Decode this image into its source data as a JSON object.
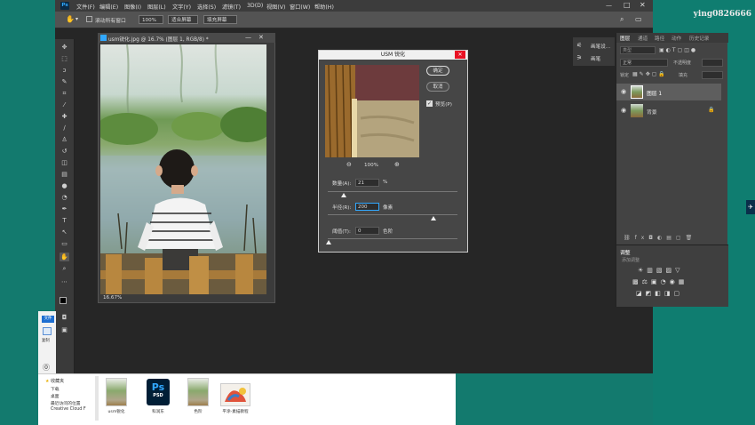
{
  "watermark": "ying0826666",
  "menu": [
    "文件(F)",
    "编辑(E)",
    "图像(I)",
    "图层(L)",
    "文字(Y)",
    "选择(S)",
    "滤镜(T)",
    "3D(D)",
    "视图(V)",
    "窗口(W)",
    "帮助(H)"
  ],
  "ps_logo": "Ps",
  "options": {
    "scroll_all": "滚动所有窗口",
    "zoom": "100%",
    "fit_screen": "适合屏幕",
    "fill_screen": "填充屏幕"
  },
  "document": {
    "title": "usm锐化.jpg @ 16.7% (图层 1, RGB/8) *",
    "zoom_status": "16.67%"
  },
  "side_panel": {
    "brush_settings": "画笔设...",
    "brushes": "画笔"
  },
  "layers_panel": {
    "tabs": [
      "图层",
      "通道",
      "路径",
      "动作",
      "历史记录"
    ],
    "kind_placeholder": "类型",
    "blend_mode": "正常",
    "opacity_label": "不透明度",
    "lock_label": "锁定",
    "fill_label": "填充",
    "layers": [
      {
        "name": "图层 1",
        "selected": true
      },
      {
        "name": "背景",
        "selected": false
      }
    ]
  },
  "adjustments_panel": {
    "title": "调整",
    "subtitle": "添加调整"
  },
  "dialog": {
    "title": "USM 锐化",
    "ok": "确定",
    "cancel": "取消",
    "preview_label": "预览(P)",
    "preview_checked": true,
    "zoom_level": "100%",
    "amount_label": "数量(A):",
    "amount_value": "21",
    "amount_unit": "%",
    "radius_label": "半径(R):",
    "radius_value": "200",
    "radius_unit": "像素",
    "threshold_label": "阈值(T):",
    "threshold_value": "0",
    "threshold_unit": "色阶"
  },
  "explorer": {
    "quick_access": "收藏夹",
    "items": [
      "下载",
      "桌面",
      "最近访问的位置",
      "Creative Cloud F"
    ],
    "side_texts": [
      "文件",
      "复制"
    ]
  },
  "shelf": [
    {
      "label": "usm锐化",
      "type": "image"
    },
    {
      "label": "PSD",
      "type": "ps-file",
      "caption": "科润东"
    },
    {
      "label": "色阶",
      "type": "image"
    },
    {
      "label": "平涂-素描教程",
      "type": "image"
    }
  ],
  "colors": {
    "ps_blue": "#31a8ff",
    "close_red": "#e81123",
    "desktop": "#137a6e"
  }
}
